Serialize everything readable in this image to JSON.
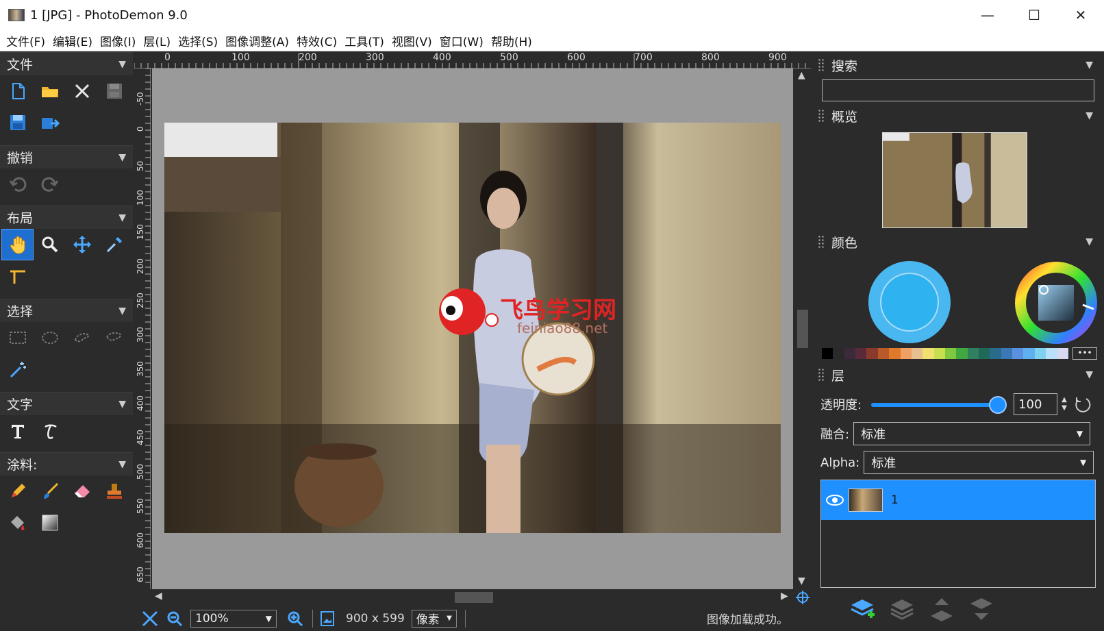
{
  "window": {
    "title": "1 [JPG]  -  PhotoDemon 9.0",
    "minimize": "—",
    "maximize": "☐",
    "close": "✕"
  },
  "menu": [
    "文件(F)",
    "编辑(E)",
    "图像(I)",
    "层(L)",
    "选择(S)",
    "图像调整(A)",
    "特效(C)",
    "工具(T)",
    "视图(V)",
    "窗口(W)",
    "帮助(H)"
  ],
  "toolbox": {
    "file": "文件",
    "undo": "撤销",
    "layout": "布局",
    "select": "选择",
    "text": "文字",
    "paint": "涂料:"
  },
  "ruler": {
    "top": [
      "0",
      "100",
      "200",
      "300",
      "400",
      "500",
      "600",
      "700",
      "800",
      "900"
    ],
    "left": [
      "-50",
      "0",
      "50",
      "100",
      "150",
      "200",
      "250",
      "300",
      "350",
      "400",
      "450",
      "500",
      "550",
      "600",
      "650"
    ]
  },
  "watermark": {
    "title": "飞鸟学习网",
    "url": "feiniao88.net"
  },
  "status": {
    "zoom": "100%",
    "size": "900 x 599",
    "unit": "像素",
    "message": "图像加载成功。"
  },
  "panels": {
    "search": "搜索",
    "overview": "概览",
    "color": "颜色",
    "layers": "层"
  },
  "layers": {
    "opacity_label": "透明度:",
    "opacity_value": "100",
    "blend_label": "融合:",
    "blend_value": "标准",
    "alpha_label": "Alpha:",
    "alpha_value": "标准",
    "layer_name": "1"
  },
  "colors": {
    "accent": "#1e90ff",
    "primary_color": "#2fb3f0",
    "palette": [
      "#000000",
      "#2a2a2a",
      "#3a2a3a",
      "#5a2a3a",
      "#8a3a2a",
      "#b85a2a",
      "#e07a2a",
      "#f0a060",
      "#e8c090",
      "#f0e070",
      "#c8e050",
      "#80c840",
      "#40a840",
      "#308060",
      "#206858",
      "#2a6a8a",
      "#3a78b8",
      "#5a90e0",
      "#60b0f0",
      "#80d0f0",
      "#b8e0f8",
      "#d8d8f0"
    ]
  }
}
